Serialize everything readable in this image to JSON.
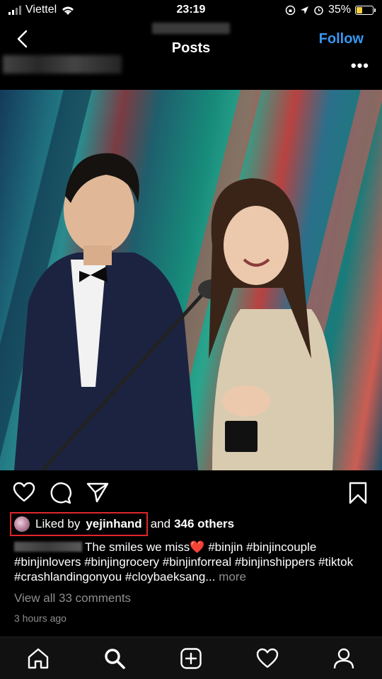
{
  "status_bar": {
    "carrier": "Viettel",
    "time": "23:19",
    "battery": "35%",
    "battery_level": 0.35
  },
  "nav": {
    "title": "Posts",
    "follow_label": "Follow"
  },
  "post": {
    "likes": {
      "prefix": "Liked by",
      "user": "yejinhand",
      "middle": "and",
      "others": "346 others"
    },
    "caption": {
      "text": "The smiles we miss",
      "emoji": "❤️",
      "hashtags": "#binjin #binjincouple #binjinlovers #binjingrocery #binjinforreal #binjinshippers #tiktok #crashlandingonyou #cloybaeksang...",
      "more": "more"
    },
    "comments_link": "View all 33 comments",
    "timestamp": "3 hours ago"
  },
  "icons": {
    "status": [
      "signal-icon",
      "wifi-icon",
      "orientation-lock-icon",
      "location-icon",
      "alarm-icon",
      "battery-icon"
    ],
    "actions": [
      "like-heart-icon",
      "comment-icon",
      "share-icon",
      "bookmark-icon"
    ],
    "tabs": [
      "home-icon",
      "search-icon",
      "add-post-icon",
      "activity-heart-icon",
      "profile-icon"
    ]
  },
  "colors": {
    "accent": "#3897f0",
    "highlight_box": "#e0262b",
    "muted_text": "#8e8e8e",
    "battery_fill": "#f4d03f"
  }
}
